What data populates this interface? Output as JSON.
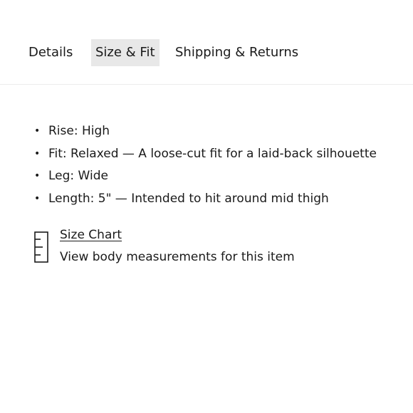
{
  "tabs": [
    {
      "label": "Details",
      "active": false
    },
    {
      "label": "Size & Fit",
      "active": true
    },
    {
      "label": "Shipping & Returns",
      "active": false
    }
  ],
  "fit_details": [
    "Rise: High",
    "Fit: Relaxed — A loose-cut fit for a laid-back silhouette",
    "Leg: Wide",
    "Length: 5\" — Intended to hit around mid thigh"
  ],
  "size_chart": {
    "icon": "ruler-icon",
    "link_label": "Size Chart",
    "description": "View body measurements for this item"
  },
  "colors": {
    "active_tab_bg": "#e8e8e8",
    "text": "#1a1a1a",
    "divider": "#ececec"
  }
}
